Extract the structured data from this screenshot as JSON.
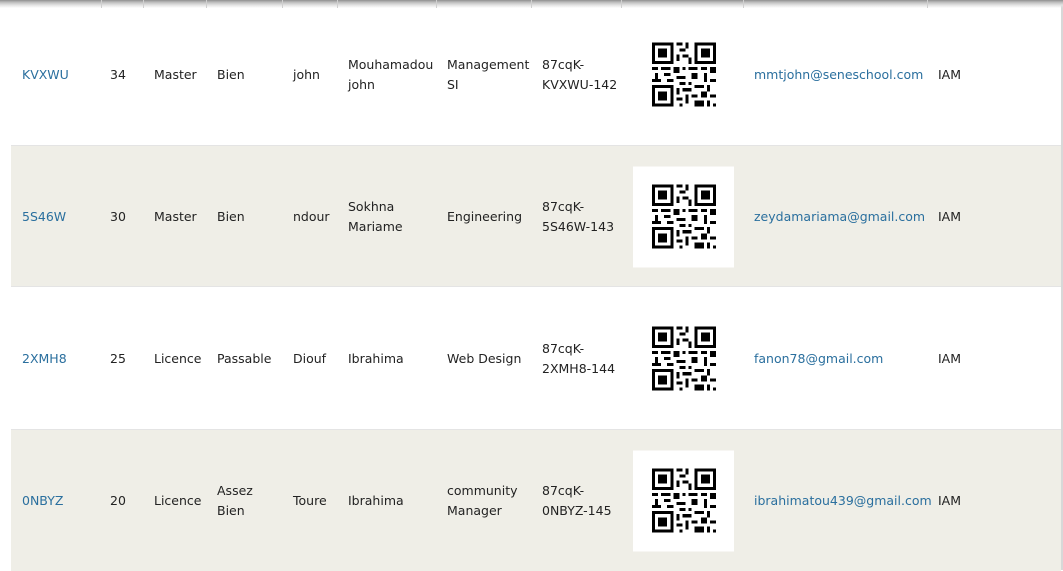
{
  "rows": [
    {
      "code": "KVXWU",
      "age": "34",
      "level": "Master",
      "mention": [
        "Bien"
      ],
      "last_name": "john",
      "first_name": [
        "Mouhamadou",
        "john"
      ],
      "program": [
        "Management",
        "SI"
      ],
      "ticket": [
        "87cqK-",
        "KVXWU-142"
      ],
      "email": "mmtjohn@seneschool.com",
      "school": "IAM"
    },
    {
      "code": "5S46W",
      "age": "30",
      "level": "Master",
      "mention": [
        "Bien"
      ],
      "last_name": "ndour",
      "first_name": [
        "Sokhna",
        "Mariame"
      ],
      "program": [
        "Engineering"
      ],
      "ticket": [
        "87cqK-",
        "5S46W-143"
      ],
      "email": "zeydamariama@gmail.com",
      "school": "IAM"
    },
    {
      "code": "2XMH8",
      "age": "25",
      "level": "Licence",
      "mention": [
        "Passable"
      ],
      "last_name": "Diouf",
      "first_name": [
        "Ibrahima"
      ],
      "program": [
        "Web Design"
      ],
      "ticket": [
        "87cqK-",
        "2XMH8-144"
      ],
      "email": "fanon78@gmail.com",
      "school": "IAM"
    },
    {
      "code": "0NBYZ",
      "age": "20",
      "level": "Licence",
      "mention": [
        "Assez",
        "Bien"
      ],
      "last_name": "Toure",
      "first_name": [
        "Ibrahima"
      ],
      "program": [
        "community",
        "Manager"
      ],
      "ticket": [
        "87cqK-",
        "0NBYZ-145"
      ],
      "email": "ibrahimatou439@gmail.com",
      "school": "IAM"
    }
  ],
  "icons": {
    "qr": "qr-code-icon"
  },
  "colors": {
    "link": "#2a6f9e",
    "row_alt": "#efeee7",
    "text": "#222222"
  }
}
